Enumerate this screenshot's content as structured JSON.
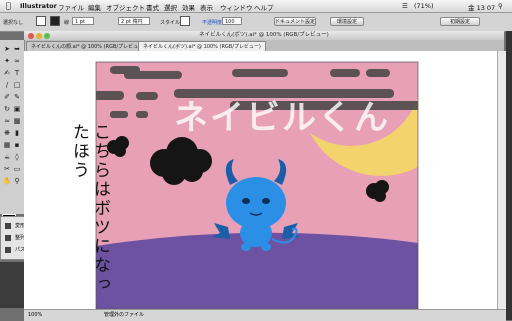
{
  "menubar": {
    "app": "Illustrator",
    "items": [
      "ファイル",
      "編集",
      "オブジェクト",
      "書式",
      "選択",
      "効果",
      "表示",
      "ウィンドウ",
      "ヘルプ"
    ],
    "battery": "(71%)",
    "clock": "金 13 07"
  },
  "control_bar": {
    "mode": "選択なし",
    "stroke_label": "線",
    "stroke_weight": "1 pt",
    "brush": "2 pt 楕円",
    "style_label": "スタイル",
    "opacity_label": "不透明度",
    "opacity": "100",
    "doc_setup": "ドキュメント設定",
    "prefs": "環境設定",
    "workspace": "初期設定"
  },
  "window": {
    "title": "ネイビルくん(ボツ).ai* @ 100% (RGB/プレビュー)"
  },
  "tabs": [
    {
      "label": "ネイビルくんの顔.ai* @ 100% (RGB/プレビュー)"
    },
    {
      "label": "ネイビルくん(ボツ).ai* @ 100% (RGB/プレビュー)"
    }
  ],
  "artwork": {
    "title_text": "ネイビルくん",
    "side_text": "こちらはボツになったほう",
    "colors": {
      "sky": "#e8a0b6",
      "moon": "#f3d36b",
      "ground": "#6e52a2",
      "devil": "#2b8fe6",
      "horns": "#1a5ea8",
      "cloud": "#151515",
      "smoke": "#3a3a3a"
    }
  },
  "panel": {
    "items": [
      "変形",
      "整列",
      "パスファインダ"
    ]
  },
  "status": {
    "zoom": "100%",
    "info": "管理外のファイル"
  },
  "icons": [
    "apple-icon",
    "wifi-icon",
    "battery-icon",
    "search-icon",
    "selection-tool-icon",
    "pen-tool-icon",
    "type-tool-icon"
  ]
}
